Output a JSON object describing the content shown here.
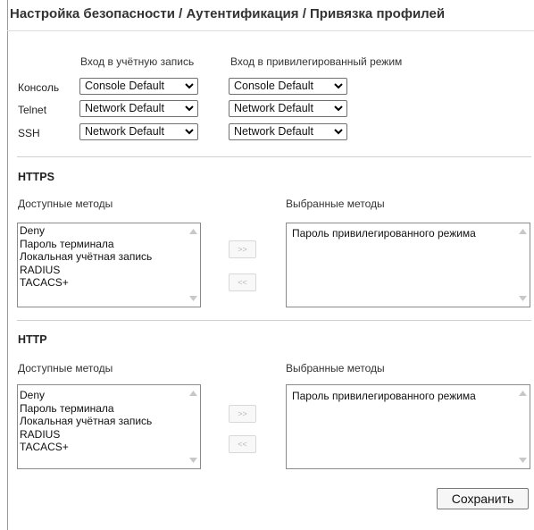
{
  "page": {
    "title": "Настройка безопасности / Аутентификация / Привязка профилей"
  },
  "login_table": {
    "col_login": "Вход в учётную запись",
    "col_privileged": "Вход в привилегированный режим",
    "rows": [
      {
        "label": "Консоль",
        "login_value": "Console Default",
        "privileged_value": "Console Default"
      },
      {
        "label": "Telnet",
        "login_value": "Network Default",
        "privileged_value": "Network Default"
      },
      {
        "label": "SSH",
        "login_value": "Network Default",
        "privileged_value": "Network Default"
      }
    ]
  },
  "https": {
    "title": "HTTPS",
    "available_label": "Доступные методы",
    "selected_label": "Выбранные методы",
    "available": [
      "Deny",
      "Пароль терминала",
      "Локальная учётная запись",
      "RADIUS",
      "TACACS+"
    ],
    "selected": [
      "Пароль привилегированного режима"
    ],
    "add_label": ">>",
    "remove_label": "<<"
  },
  "http": {
    "title": "HTTP",
    "available_label": "Доступные методы",
    "selected_label": "Выбранные методы",
    "available": [
      "Deny",
      "Пароль терминала",
      "Локальная учётная запись",
      "RADIUS",
      "TACACS+"
    ],
    "selected": [
      "Пароль привилегированного режима"
    ],
    "add_label": ">>",
    "remove_label": "<<"
  },
  "actions": {
    "save_label": "Сохранить"
  },
  "icons": {
    "dropdown": "chevron-down-icon",
    "scroll_up": "scroll-up-arrow-icon",
    "scroll_down": "scroll-down-arrow-icon"
  }
}
